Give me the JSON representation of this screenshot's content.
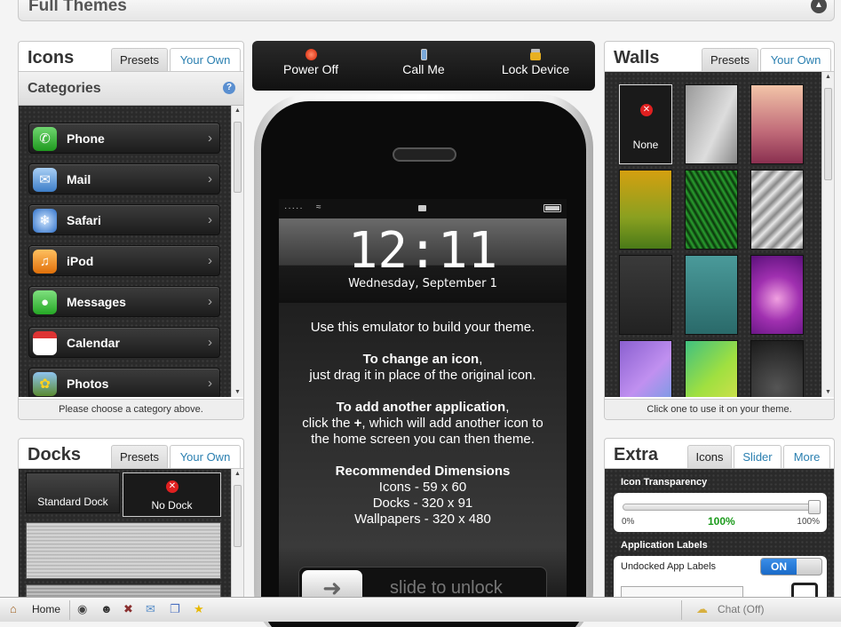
{
  "header": {
    "title": "Full Themes",
    "toggle_icon": "chevron-updown-icon"
  },
  "icons_panel": {
    "title": "Icons",
    "tabs": [
      "Presets",
      "Your Own"
    ],
    "categories_label": "Categories",
    "help_icon": "help-icon",
    "categories": [
      {
        "label": "Phone",
        "icon": "phone-icon",
        "color": "#2fb12f"
      },
      {
        "label": "Mail",
        "icon": "mail-icon",
        "color": "#4d8fd8"
      },
      {
        "label": "Safari",
        "icon": "safari-icon",
        "color": "#3d7fd6"
      },
      {
        "label": "iPod",
        "icon": "ipod-icon",
        "color": "#f08a18"
      },
      {
        "label": "Messages",
        "icon": "messages-icon",
        "color": "#3fc03f"
      },
      {
        "label": "Calendar",
        "icon": "calendar-icon",
        "color": "#e8e8e8"
      },
      {
        "label": "Photos",
        "icon": "photos-icon",
        "color": "#7a9a3a"
      }
    ],
    "footer": "Please choose a category above."
  },
  "docks_panel": {
    "title": "Docks",
    "tabs": [
      "Presets",
      "Your Own"
    ],
    "options": [
      {
        "label": "Standard Dock"
      },
      {
        "label": "No Dock"
      }
    ]
  },
  "controls": [
    {
      "label": "Power Off",
      "icon": "power-icon"
    },
    {
      "label": "Call Me",
      "icon": "phone-handset-icon"
    },
    {
      "label": "Lock Device",
      "icon": "lock-icon"
    }
  ],
  "phone": {
    "time": "12:11",
    "date": "Wednesday, September 1",
    "intro": "Use this emulator to build your theme.",
    "change_heading": "To change an icon",
    "change_heading_suffix": ",",
    "change_body": "just drag it in place of the original icon.",
    "add_heading": "To add another application",
    "add_heading_suffix": ",",
    "add_body_1a": "click the ",
    "add_body_plus": "+",
    "add_body_1b": ", which will add another icon to",
    "add_body_2": "the home screen you can then theme.",
    "dims_heading": "Recommended Dimensions",
    "dims": [
      "Icons - 59 x 60",
      "Docks - 320 x 91",
      "Wallpapers - 320 x 480"
    ],
    "slider_text": "slide to unlock"
  },
  "walls_panel": {
    "title": "Walls",
    "tabs": [
      "Presets",
      "Your Own"
    ],
    "none_label": "None",
    "footer": "Click one to use it on your theme."
  },
  "extra_panel": {
    "title": "Extra",
    "tabs": [
      "Icons",
      "Slider",
      "More"
    ],
    "icon_transparency_label": "Icon Transparency",
    "transparency_value": 100,
    "slider_min": "0%",
    "slider_value_label": "100%",
    "slider_max": "100%",
    "app_labels_label": "Application Labels",
    "undocked_label": "Undocked App Labels",
    "toggle_state": "ON"
  },
  "bottom_bar": {
    "home_label": "Home",
    "chat_label": "Chat (Off)"
  }
}
